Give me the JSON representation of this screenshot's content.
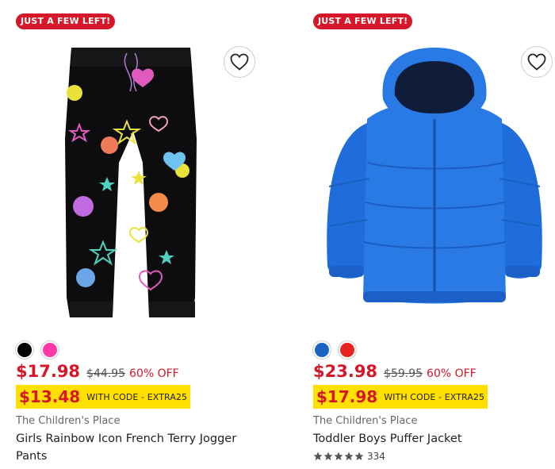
{
  "products": [
    {
      "badge": "JUST A FEW LEFT!",
      "favorite_icon": "heart-outline-icon",
      "image": "girls-rainbow-jogger-pants",
      "swatches": [
        {
          "name": "black",
          "color": "#000000"
        },
        {
          "name": "pink",
          "color": "#ff3aa8"
        }
      ],
      "price": "$17.98",
      "original_price": "$44.95",
      "discount": "60% OFF",
      "code_price": "$13.48",
      "code_label": "WITH CODE - EXTRA25",
      "brand": "The Children's Place",
      "title": "Girls Rainbow Icon French Terry Jogger Pants"
    },
    {
      "badge": "JUST A FEW LEFT!",
      "favorite_icon": "heart-outline-icon",
      "image": "toddler-boys-puffer-jacket",
      "swatches": [
        {
          "name": "blue",
          "color": "#1c63c6"
        },
        {
          "name": "red",
          "color": "#e8231f"
        }
      ],
      "price": "$23.98",
      "original_price": "$59.95",
      "discount": "60% OFF",
      "code_price": "$17.98",
      "code_label": "WITH CODE - EXTRA25",
      "brand": "The Children's Place",
      "title": "Toddler Boys Puffer Jacket",
      "rating": {
        "stars": 5,
        "count": "334"
      }
    }
  ],
  "colors": {
    "sale_red": "#d6172a",
    "code_yellow": "#ffe000",
    "star_gray": "#555555"
  }
}
